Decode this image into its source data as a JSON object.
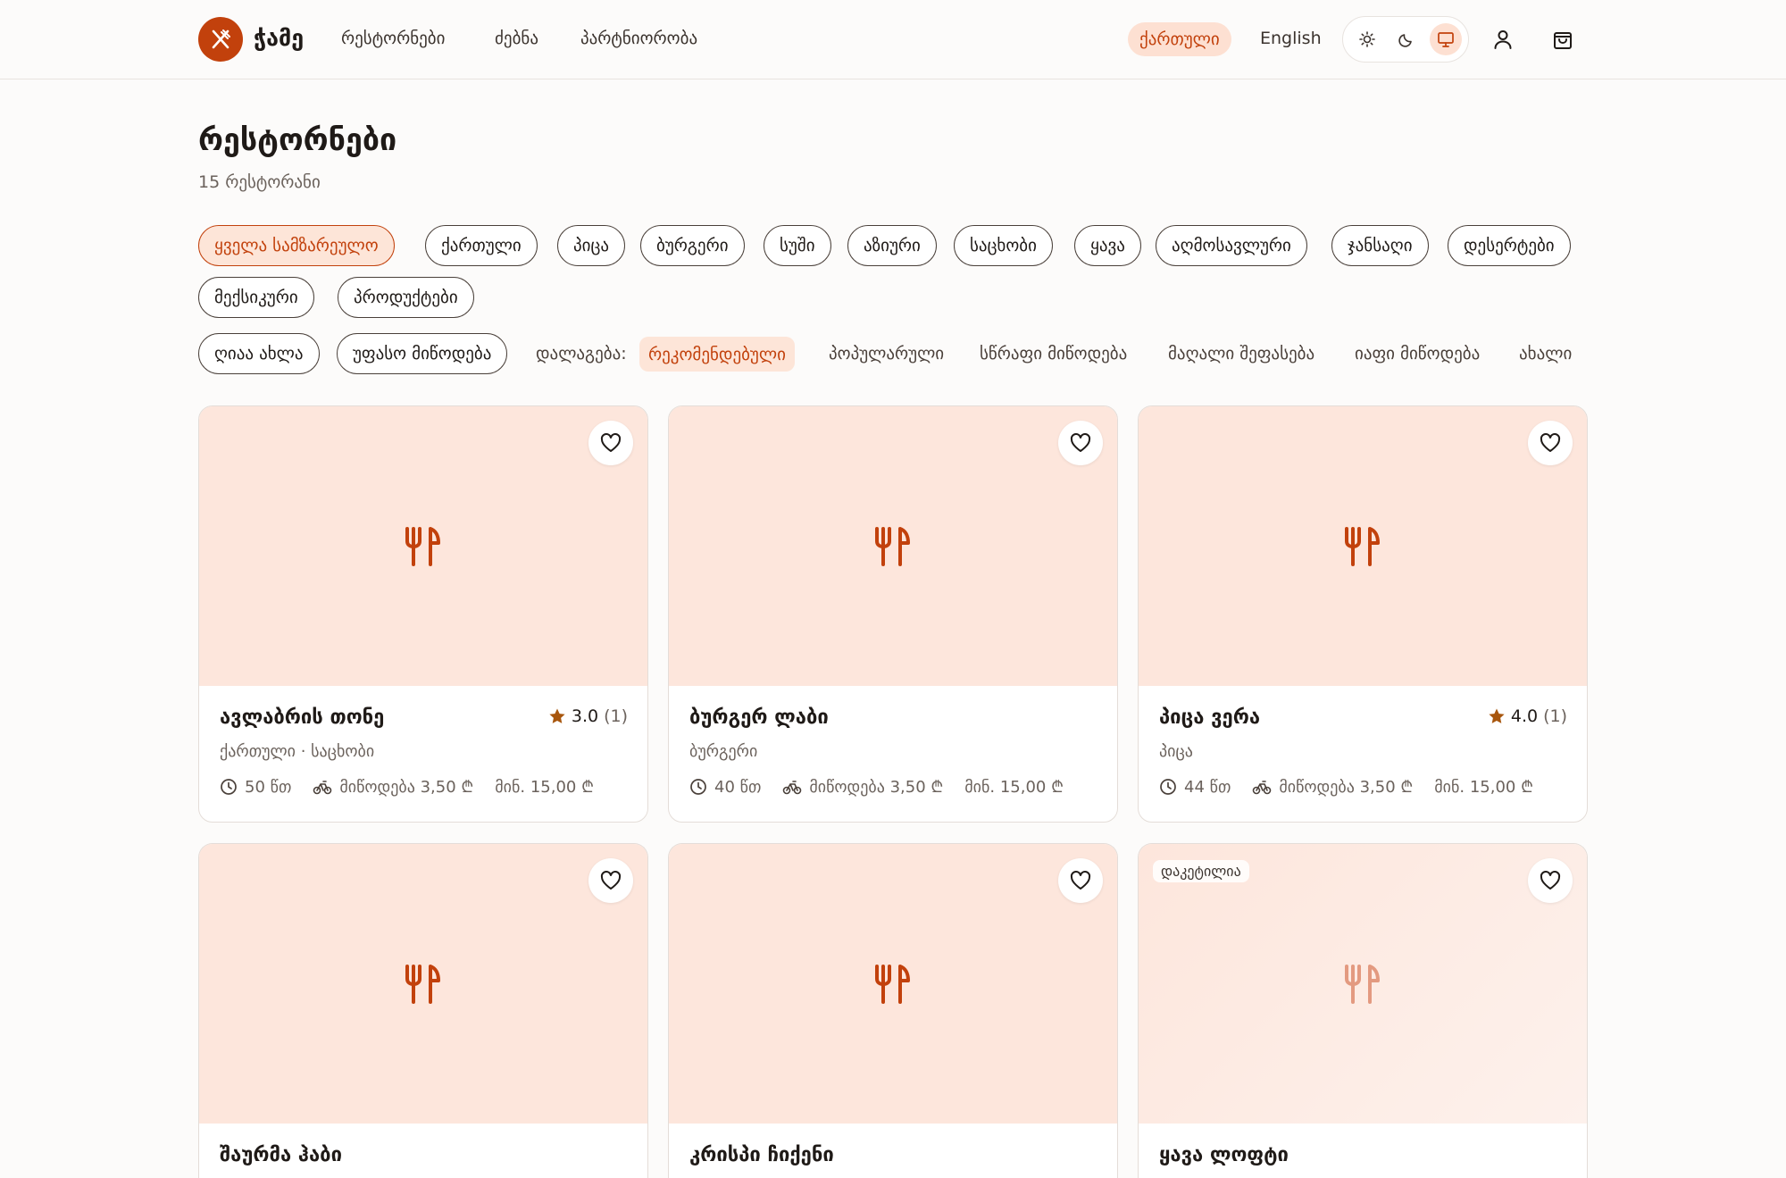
{
  "header": {
    "brand": "ჭამე",
    "nav": [
      "რესტორნები",
      "ძებნა",
      "პარტნიორობა"
    ],
    "lang_active": "ქართული",
    "lang_other": "English",
    "accent": "#c2410c"
  },
  "page": {
    "title": "რესტორნები",
    "count": "15 რესტორანი"
  },
  "cuisines": [
    "ყველა სამზარეულო",
    "ქართული",
    "პიცა",
    "ბურგერი",
    "სუში",
    "აზიური",
    "საცხობი",
    "ყავა",
    "აღმოსავლური",
    "ჯანსაღი",
    "დესერტები",
    "მექსიკური",
    "პროდუქტები"
  ],
  "filters": {
    "open_now": "ღიაა ახლა",
    "free_delivery": "უფასო მიწოდება"
  },
  "sort": {
    "label": "დალაგება:",
    "options": [
      "რეკომენდებული",
      "პოპულარული",
      "სწრაფი მიწოდება",
      "მაღალი შეფასება",
      "იაფი მიწოდება",
      "ახალი"
    ]
  },
  "restaurants": [
    {
      "name": "ავლაბრის თონე",
      "rating": "3.0",
      "rating_count": "(1)",
      "cuisine": "ქართული · საცხობი",
      "time": "50 წთ",
      "delivery": "მიწოდება 3,50 ₾",
      "min": "მინ. 15,00 ₾"
    },
    {
      "name": "ბურგერ ლაბი",
      "rating": "",
      "rating_count": "",
      "cuisine": "ბურგერი",
      "time": "40 წთ",
      "delivery": "მიწოდება 3,50 ₾",
      "min": "მინ. 15,00 ₾"
    },
    {
      "name": "პიცა ვერა",
      "rating": "4.0",
      "rating_count": "(1)",
      "cuisine": "პიცა",
      "time": "44 წთ",
      "delivery": "მიწოდება 3,50 ₾",
      "min": "მინ. 15,00 ₾"
    },
    {
      "name": "შაურმა ჰაბი"
    },
    {
      "name": "კრისპი ჩიქენი"
    },
    {
      "name": "ყავა ლოფტი",
      "badge": "დაკეტილია"
    }
  ]
}
